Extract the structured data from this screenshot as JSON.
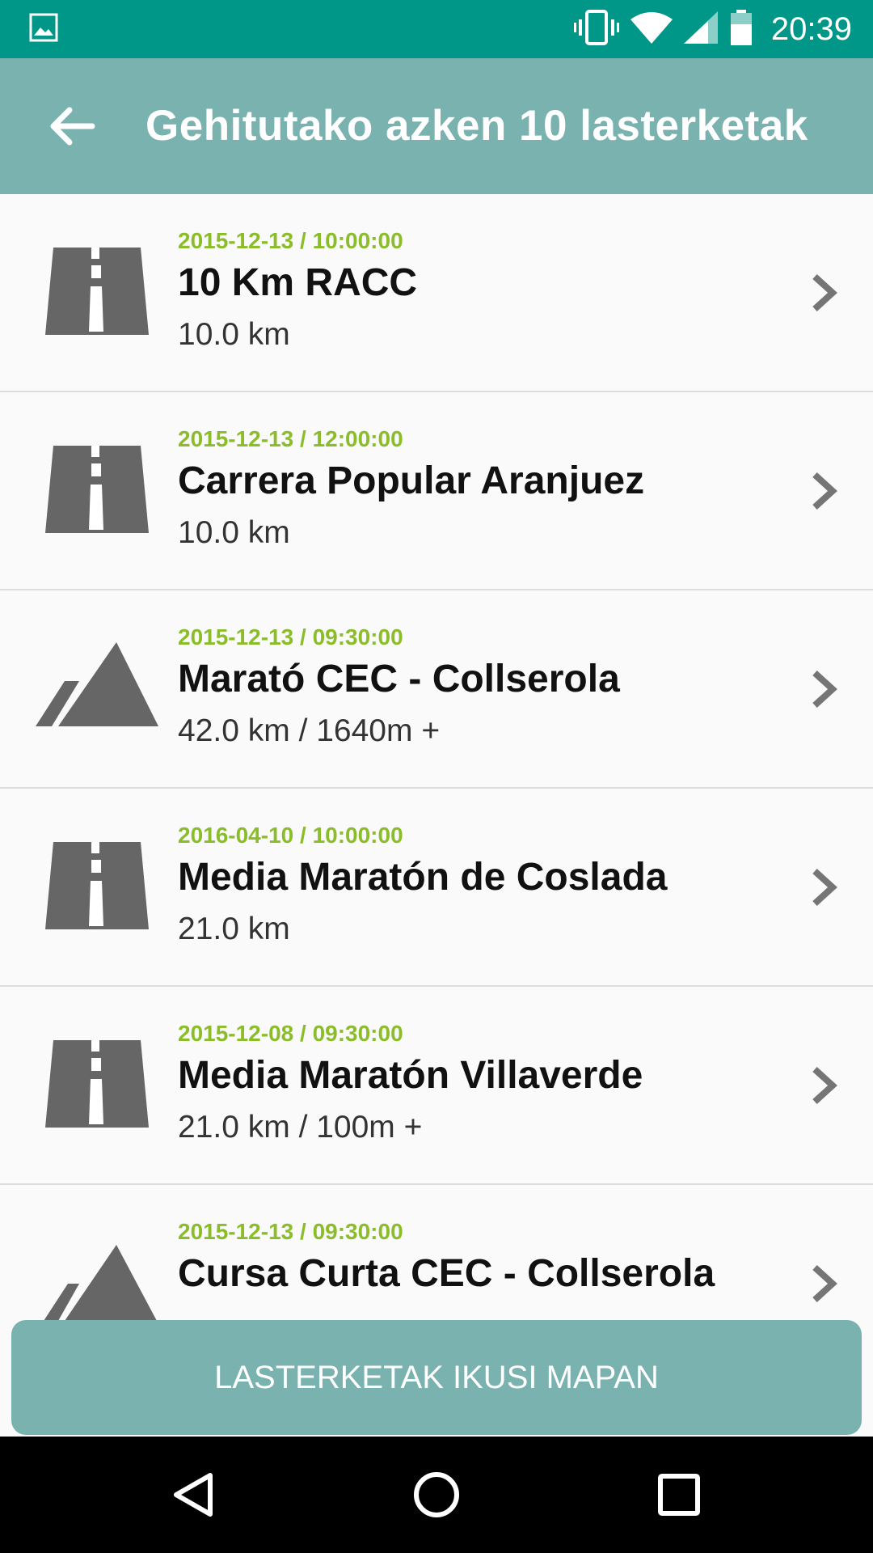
{
  "status_bar": {
    "time": "20:39",
    "icons": [
      "image-icon",
      "vibrate-icon",
      "wifi-icon",
      "signal-icon",
      "battery-icon"
    ]
  },
  "toolbar": {
    "title": "Gehitutako azken 10 lasterketak",
    "back_icon": "arrow-left-icon"
  },
  "races": [
    {
      "date": "2015-12-13 / 10:00:00",
      "name": "10 Km RACC",
      "distance": "10.0 km",
      "icon": "road-icon"
    },
    {
      "date": "2015-12-13 / 12:00:00",
      "name": "Carrera Popular Aranjuez",
      "distance": "10.0 km",
      "icon": "road-icon"
    },
    {
      "date": "2015-12-13 / 09:30:00",
      "name": "Marató CEC - Collserola",
      "distance": "42.0 km / 1640m +",
      "icon": "mountain-icon"
    },
    {
      "date": "2016-04-10 / 10:00:00",
      "name": "Media Maratón de Coslada",
      "distance": "21.0 km",
      "icon": "road-icon"
    },
    {
      "date": "2015-12-08 / 09:30:00",
      "name": "Media Maratón Villaverde",
      "distance": "21.0 km / 100m +",
      "icon": "road-icon"
    },
    {
      "date": "2015-12-13 / 09:30:00",
      "name": "Cursa Curta CEC - Collserola",
      "distance": "",
      "icon": "mountain-icon"
    }
  ],
  "map_button": {
    "label": "LASTERKETAK IKUSI MAPAN"
  },
  "colors": {
    "status_bar": "#009688",
    "toolbar": "#7ab2b0",
    "date_text": "#8bbd2a",
    "icon_gray": "#666666"
  }
}
